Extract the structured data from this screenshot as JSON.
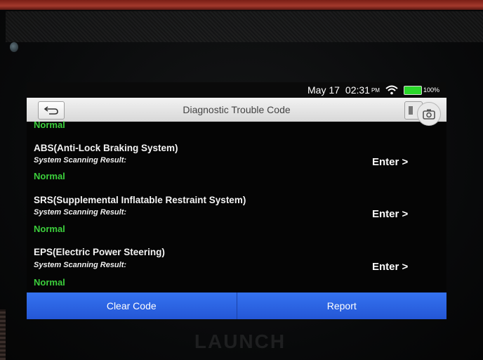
{
  "device": {
    "brand_logo": "LAUNCH"
  },
  "status_bar": {
    "date": "May 17",
    "time": "02:31",
    "ampm": "PM",
    "battery": "100%"
  },
  "header": {
    "title": "Diagnostic Trouble Code"
  },
  "list": {
    "top_partial_status": "Normal",
    "systems": [
      {
        "name": "ABS(Anti-Lock Braking System)",
        "scan_label": "System Scanning Result:",
        "status": "Normal",
        "enter_label": "Enter >"
      },
      {
        "name": "SRS(Supplemental Inflatable Restraint System)",
        "scan_label": "System Scanning Result:",
        "status": "Normal",
        "enter_label": "Enter >"
      },
      {
        "name": "EPS(Electric Power Steering)",
        "scan_label": "System Scanning Result:",
        "status": "Normal",
        "enter_label": "Enter >"
      }
    ]
  },
  "bottom_bar": {
    "clear_code_label": "Clear Code",
    "report_label": "Report"
  },
  "colors": {
    "status_normal": "#3ccf3c",
    "button_blue": "#2f6aeb",
    "battery_green": "#2ad82a"
  },
  "icons": {
    "back": "back-arrow-icon",
    "wifi": "wifi-icon",
    "battery": "battery-icon",
    "camera": "camera-icon",
    "menu": "menu-icon"
  }
}
